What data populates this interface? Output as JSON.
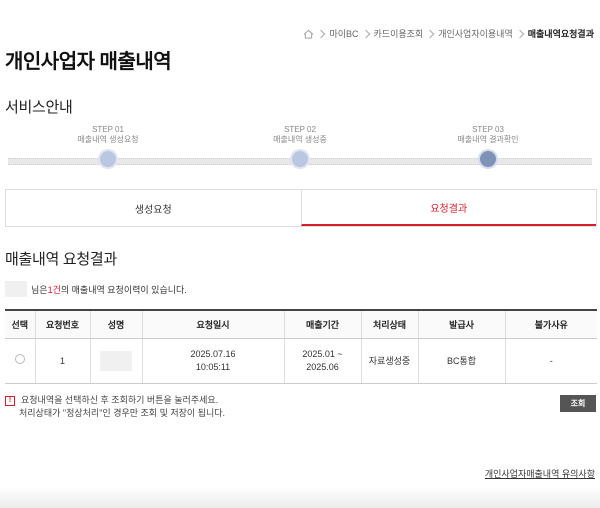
{
  "breadcrumb": {
    "items": [
      "마이BC",
      "카드이용조회",
      "개인사업자이용내역"
    ],
    "current": "매출내역요청결과"
  },
  "page_title": "개인사업자 매출내역",
  "service_guide": {
    "heading": "서비스안내",
    "steps": [
      {
        "num": "STEP 01",
        "label": "매출내역 생성요청"
      },
      {
        "num": "STEP 02",
        "label": "매출내역 생성중"
      },
      {
        "num": "STEP 03",
        "label": "매출내역 결과확인"
      }
    ]
  },
  "tabs": {
    "request": "생성요청",
    "result": "요청결과"
  },
  "result_section": {
    "heading": "매출내역 요청결과",
    "info_pre": "님은 ",
    "info_count": "1건",
    "info_post": "의 매출내역 요청이력이 있습니다."
  },
  "table": {
    "headers": [
      "선택",
      "요청번호",
      "성명",
      "요청일시",
      "매출기간",
      "처리상태",
      "발급사",
      "불가사유"
    ],
    "row": {
      "no": "1",
      "date1": "2025.07.16",
      "date2": "10:05:11",
      "period1": "2025.01 ~",
      "period2": "2025.06",
      "status": "자료생성중",
      "issuer": "BC통합",
      "reason": "-"
    }
  },
  "notice": {
    "line1": "요청내역을 선택하신 후 조회하기 버튼을 눌러주세요.",
    "line2": "처리상태가 \"정상처리\"인 경우만 조회 및 저장이 됩니다."
  },
  "buttons": {
    "query": "조회"
  },
  "footer_link": "개인사업자매출내역 유의사항",
  "colors": {
    "accent": "#d4202c",
    "step_dot": "#b9c7e2",
    "step_dot_active": "#7f93b9"
  }
}
